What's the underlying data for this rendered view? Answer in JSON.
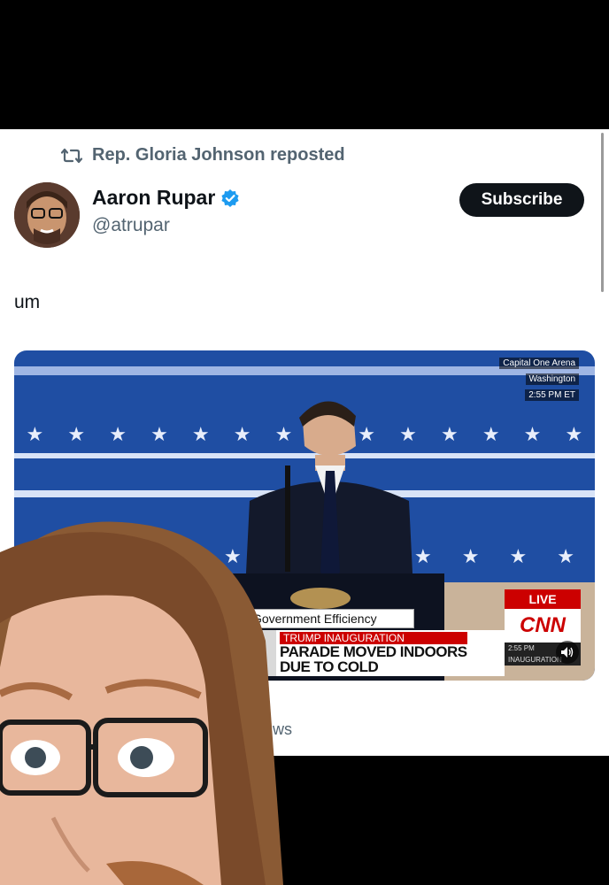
{
  "tweet": {
    "repost_label": "Rep. Gloria Johnson reposted",
    "author": {
      "display_name": "Aaron Rupar",
      "handle": "@atrupar"
    },
    "subscribe_label": "Subscribe",
    "text": "um",
    "media_trailing_label": "ws"
  },
  "video": {
    "bug_location": "Capital One Arena",
    "bug_city": "Washington",
    "bug_time": "2:55 PM ET",
    "chyron_tag": "Government Efficiency",
    "chyron_kicker": "TRUMP INAUGURATION",
    "chyron_headline_1": "PARADE MOVED INDOORS",
    "chyron_headline_2": "DUE TO COLD",
    "live_label": "LIVE",
    "network_logo": "CNN",
    "cnn_time": "2:55 PM",
    "cnn_program": "INAUGURATION"
  },
  "colors": {
    "verified": "#1d9bf0",
    "live": "#cc0000",
    "subscribe_bg": "#0f1419"
  }
}
